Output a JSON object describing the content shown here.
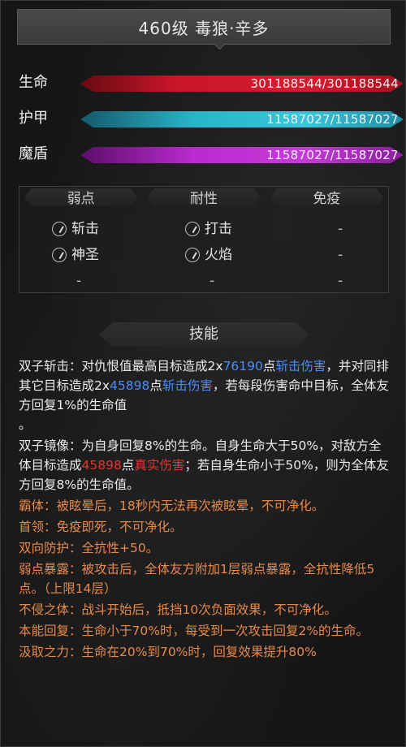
{
  "header": {
    "title": "460级 毒狼·辛多"
  },
  "stats": [
    {
      "label": "生命",
      "value": "301188544/301188544",
      "color": "#d61b30"
    },
    {
      "label": "护甲",
      "value": "11587027/11587027",
      "color": "#38c6d8"
    },
    {
      "label": "魔盾",
      "value": "11587027/11587027",
      "color": "#c53bd8"
    }
  ],
  "resistances": {
    "headers": [
      "弱点",
      "耐性",
      "免疫"
    ],
    "weak": [
      "斩击",
      "神圣",
      "-"
    ],
    "resist": [
      "打击",
      "火焰",
      "-"
    ],
    "immune": [
      "-",
      "-",
      "-"
    ],
    "weak_icons": [
      "slash-icon",
      "holy-icon"
    ],
    "resist_icons": [
      "blunt-icon",
      "fire-icon"
    ]
  },
  "skills_header": "技能",
  "skills": {
    "s1": {
      "name": "双子斩击：",
      "a": "对仇恨值最高目标造成2x",
      "n1": "76190",
      "b": "点",
      "d1": "斩击伤害",
      "c": "，并对同排其它目标造成2x",
      "n2": "45898",
      "e": "点",
      "d2": "斩击伤害",
      "f": "，若每段伤害命中目标，全体友方回复1%的生命值",
      "g": "。"
    },
    "s2": {
      "name": "双子镜像：",
      "a": "为自身回复8%的生命。自身生命大于50%，对敌方全体目标造成",
      "n1": "45898",
      "b": "点",
      "d1": "真实伤害",
      "c": "；若自身生命小于50%，则为全体友方回复8%的生命值。"
    },
    "s3": {
      "name": "霸体：",
      "text": "被眩晕后，18秒内无法再次被眩晕，不可净化。"
    },
    "s4": {
      "name": "首领：",
      "text": "免疫即死，不可净化。"
    },
    "s5": {
      "name": "双向防护：",
      "text": "全抗性+50。"
    },
    "s6": {
      "name": "弱点暴露：",
      "text": "被攻击后，全体友方附加1层弱点暴露，全抗性降低5点。（上限14层）"
    },
    "s7": {
      "name": "不侵之体：",
      "text": "战斗开始后，抵挡10次负面效果，不可净化。"
    },
    "s8": {
      "name": "本能回复：",
      "text": "生命小于70%时，每受到一次攻击回复2%的生命。"
    },
    "s9": {
      "name": "汲取之力：",
      "text": "生命在20%到70%时，回复效果提升80%"
    }
  }
}
